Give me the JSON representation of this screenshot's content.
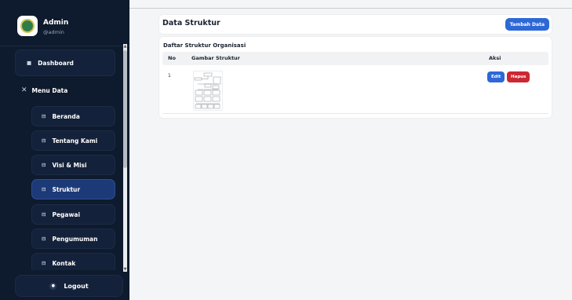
{
  "sidebar": {
    "profile": {
      "name": "Admin",
      "username": "@admin"
    },
    "dashboard": {
      "icon": "dashboard-icon",
      "label": "Dashboard"
    },
    "menu_data": {
      "icon": "close-icon",
      "label": "Menu Data"
    },
    "submenu": [
      {
        "label": "Beranda",
        "icon": "list-icon",
        "active": false
      },
      {
        "label": "Tentang Kami",
        "icon": "list-icon",
        "active": false
      },
      {
        "label": "Visi & Misi",
        "icon": "list-icon",
        "active": false
      },
      {
        "label": "Struktur",
        "icon": "list-icon",
        "active": true
      },
      {
        "label": "Pegawai",
        "icon": "list-icon",
        "active": false
      },
      {
        "label": "Pengumuman",
        "icon": "list-icon",
        "active": false
      },
      {
        "label": "Kontak",
        "icon": "list-icon",
        "active": false
      }
    ],
    "logout": {
      "label": "Logout",
      "icon": "power-icon"
    }
  },
  "main": {
    "page_title": "Data Struktur",
    "add_button": "Tambah Data",
    "table": {
      "title": "Daftar Struktur Organisasi",
      "columns": [
        "No",
        "Gambar Struktur",
        "Aksi"
      ],
      "rows": [
        {
          "no": "1",
          "image": "org-chart-thumbnail",
          "edit_label": "Edit",
          "delete_label": "Hapus"
        }
      ]
    }
  },
  "colors": {
    "sidebar_bg": "#0e1a2d",
    "active_item": "#1d3a78",
    "primary": "#2d68d6",
    "danger": "#cc2733"
  }
}
